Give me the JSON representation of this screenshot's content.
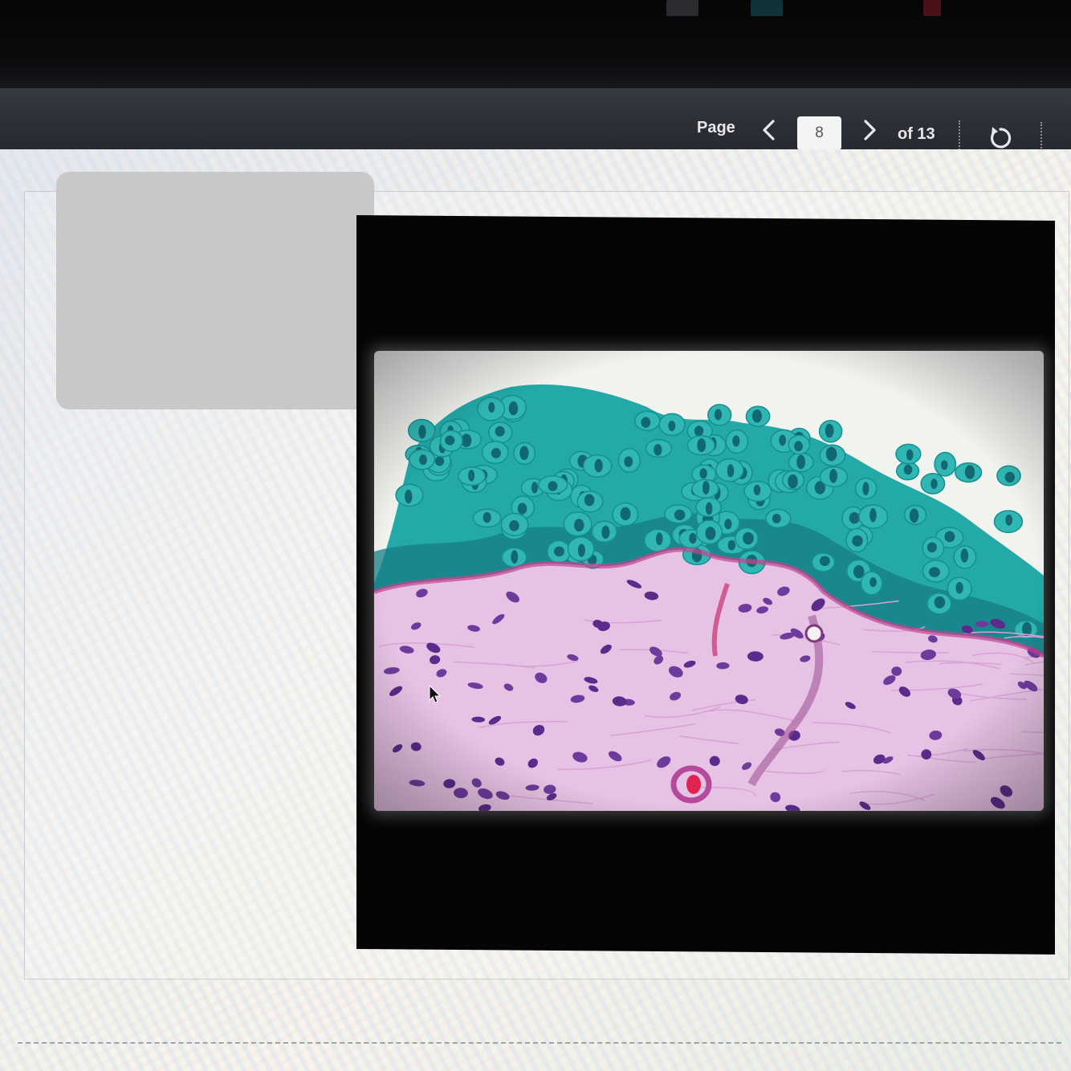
{
  "toolbar": {
    "page_label": "Page",
    "current_page": "8",
    "total_pages_label": "of 13",
    "prev_icon": "chevron-left-icon",
    "next_icon": "chevron-right-icon",
    "rotate_icon": "rotate-icon"
  },
  "colors": {
    "toolbar_bg": "#2c3036",
    "epithelium": "#1fa6a4",
    "connective_tissue": "#e7c6e3",
    "nuclei": "#5b2a8a"
  }
}
